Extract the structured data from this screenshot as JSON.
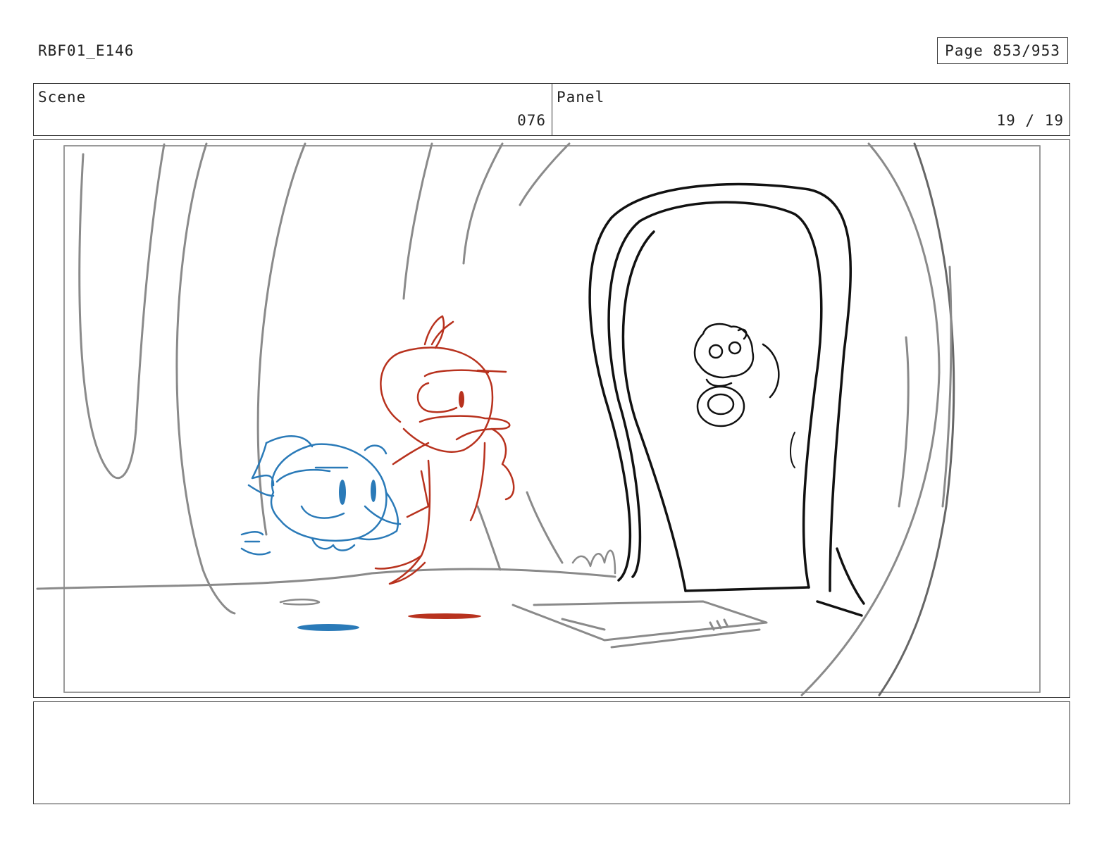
{
  "header": {
    "production_id": "RBF01_E146",
    "page_label": "Page 853/953"
  },
  "scene": {
    "label": "Scene",
    "value": "076"
  },
  "panel": {
    "label": "Panel",
    "value": "19 / 19"
  },
  "notes": {
    "text": ""
  },
  "colors": {
    "blue_character": "#2a7ab8",
    "red_character": "#b8321e",
    "linework": "#111111",
    "background_lines": "#8a8a8a"
  }
}
